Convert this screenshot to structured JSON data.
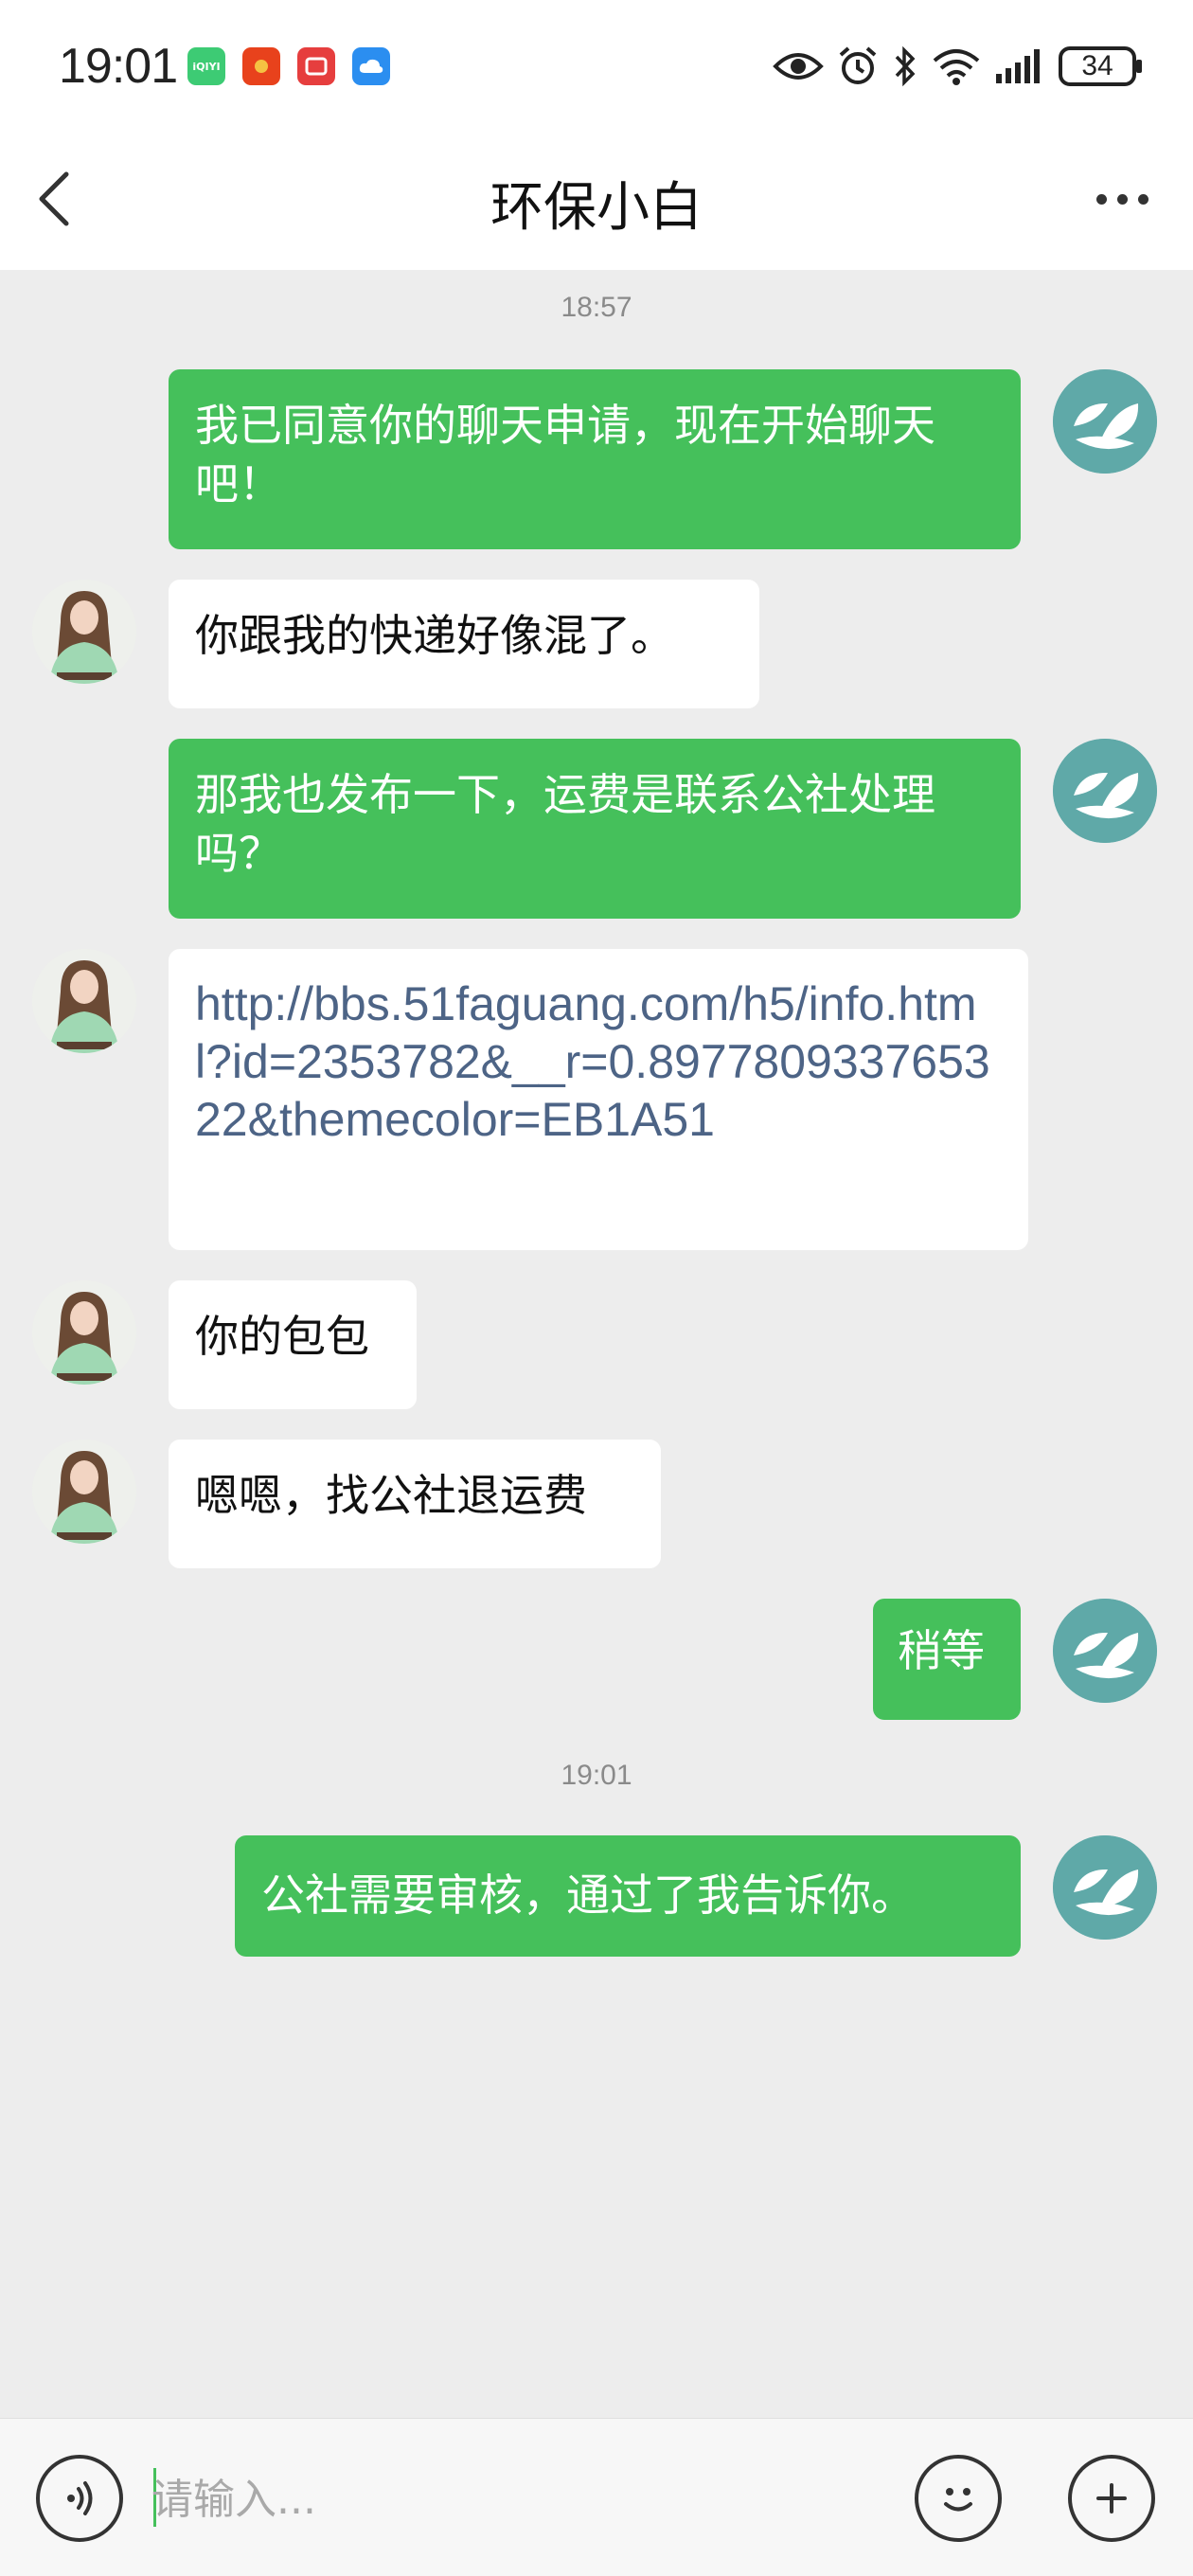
{
  "status_bar": {
    "time": "19:01",
    "battery": "34",
    "app_icons": [
      {
        "name": "iqiyi-icon",
        "label": "iQIYI",
        "color": "#3dcb74"
      },
      {
        "name": "red-envelope-icon",
        "label": "",
        "color": "#e8421c"
      },
      {
        "name": "red-app-icon",
        "label": "",
        "color": "#e63e3e"
      },
      {
        "name": "cloud-icon",
        "label": "",
        "color": "#2b8ef0"
      }
    ]
  },
  "nav": {
    "title": "环保小白"
  },
  "messages": [
    {
      "type": "timestamp",
      "text": "18:57"
    },
    {
      "type": "out",
      "text": "我已同意你的聊天申请，现在开始聊天吧！"
    },
    {
      "type": "in",
      "text": "你跟我的快递好像混了。"
    },
    {
      "type": "out",
      "text": "那我也发布一下，运费是联系公社处理吗？"
    },
    {
      "type": "in-link",
      "text": "http://bbs.51faguang.com/h5/info.html?id=2353782&__r=0.897780933765322&themecolor=EB1A51"
    },
    {
      "type": "in",
      "text": "你的包包"
    },
    {
      "type": "in",
      "text": "嗯嗯，找公社退运费"
    },
    {
      "type": "out",
      "text": "稍等"
    },
    {
      "type": "timestamp",
      "text": "19:01"
    },
    {
      "type": "out",
      "text": "公社需要审核，通过了我告诉你。"
    }
  ],
  "input": {
    "placeholder": "请输入..."
  },
  "colors": {
    "outgoing_bubble": "#45c05b",
    "incoming_bubble": "#ffffff",
    "link_text": "#4d6486",
    "background": "#ededed"
  }
}
